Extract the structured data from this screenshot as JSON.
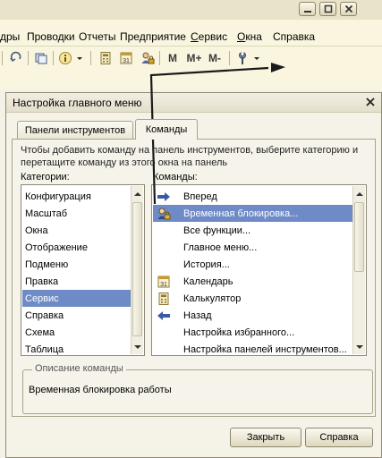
{
  "menu": {
    "items": [
      {
        "pre": "",
        "ul": "",
        "post": "дры"
      },
      {
        "pre": "",
        "ul": "",
        "post": "Проводки"
      },
      {
        "pre": "",
        "ul": "",
        "post": "Отчеты"
      },
      {
        "pre": "",
        "ul": "",
        "post": "Предприятие"
      },
      {
        "pre": "",
        "ul": "С",
        "post": "ервис"
      },
      {
        "pre": "",
        "ul": "О",
        "post": "кна"
      },
      {
        "pre": "",
        "ul": "",
        "post": "Справка"
      }
    ]
  },
  "toolbar": {
    "m_label": "M",
    "m_plus_label": "M+",
    "m_minus_label": "M-"
  },
  "dialog": {
    "title": "Настройка главного меню",
    "tabs": [
      "Панели инструментов",
      "Команды"
    ],
    "active_tab": "Команды",
    "hint": "Чтобы добавить команду на панель инструментов, выберите категорию и перетащите команду из этого окна на панель",
    "categories_label": "Категории:",
    "commands_label": "Команды:",
    "categories": [
      "Конфигурация",
      "Масштаб",
      "Окна",
      "Отображение",
      "Подменю",
      "Правка",
      "Сервис",
      "Справка",
      "Схема",
      "Таблица"
    ],
    "selected_category": "Сервис",
    "commands": [
      {
        "label": "Вперед",
        "icon": "forward-arrow-icon"
      },
      {
        "label": "Временная блокировка...",
        "icon": "lock-person-icon"
      },
      {
        "label": "Все функции...",
        "icon": ""
      },
      {
        "label": "Главное меню...",
        "icon": ""
      },
      {
        "label": "История...",
        "icon": ""
      },
      {
        "label": "Календарь",
        "icon": "calendar-icon"
      },
      {
        "label": "Калькулятор",
        "icon": "calculator-icon"
      },
      {
        "label": "Назад",
        "icon": "back-arrow-icon"
      },
      {
        "label": "Настройка избранного...",
        "icon": ""
      },
      {
        "label": "Настройка панелей инструментов...",
        "icon": ""
      }
    ],
    "selected_command": "Временная блокировка...",
    "description_legend": "Описание команды",
    "description_text": "Временная блокировка работы",
    "close_button": "Закрыть",
    "help_button": "Справка"
  },
  "colors": {
    "selection": "#6f8bc7",
    "annotation_arrow": "#1a1a1a"
  }
}
